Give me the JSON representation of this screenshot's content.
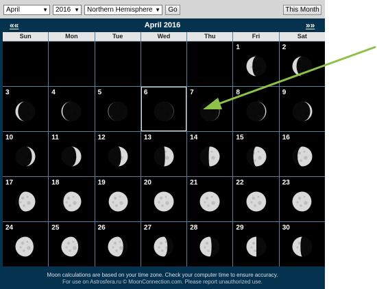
{
  "controls": {
    "month": "April",
    "year": "2016",
    "hemisphere": "Northern Hemisphere",
    "go_label": "Go",
    "this_month_label": "This Month"
  },
  "calendar": {
    "prev_label": "««",
    "next_label": "»»",
    "title": "April 2016",
    "weekdays": [
      "Sun",
      "Mon",
      "Tue",
      "Wed",
      "Thu",
      "Fri",
      "Sat"
    ],
    "today": 6,
    "days": [
      {
        "day": 1,
        "illum": 0.3,
        "waxing": false
      },
      {
        "day": 2,
        "illum": 0.21,
        "waxing": false
      },
      {
        "day": 3,
        "illum": 0.13,
        "waxing": false
      },
      {
        "day": 4,
        "illum": 0.06,
        "waxing": false
      },
      {
        "day": 5,
        "illum": 0.02,
        "waxing": false
      },
      {
        "day": 6,
        "illum": 0.01,
        "waxing": true
      },
      {
        "day": 7,
        "illum": 0.02,
        "waxing": true
      },
      {
        "day": 8,
        "illum": 0.05,
        "waxing": true
      },
      {
        "day": 9,
        "illum": 0.1,
        "waxing": true
      },
      {
        "day": 10,
        "illum": 0.17,
        "waxing": true
      },
      {
        "day": 11,
        "illum": 0.25,
        "waxing": true
      },
      {
        "day": 12,
        "illum": 0.34,
        "waxing": true
      },
      {
        "day": 13,
        "illum": 0.44,
        "waxing": true
      },
      {
        "day": 14,
        "illum": 0.55,
        "waxing": true
      },
      {
        "day": 15,
        "illum": 0.65,
        "waxing": true
      },
      {
        "day": 16,
        "illum": 0.74,
        "waxing": true
      },
      {
        "day": 17,
        "illum": 0.83,
        "waxing": true
      },
      {
        "day": 18,
        "illum": 0.9,
        "waxing": true
      },
      {
        "day": 19,
        "illum": 0.96,
        "waxing": true
      },
      {
        "day": 20,
        "illum": 0.99,
        "waxing": true
      },
      {
        "day": 21,
        "illum": 1.0,
        "waxing": true
      },
      {
        "day": 22,
        "illum": 0.99,
        "waxing": false
      },
      {
        "day": 23,
        "illum": 0.96,
        "waxing": false
      },
      {
        "day": 24,
        "illum": 0.91,
        "waxing": false
      },
      {
        "day": 25,
        "illum": 0.85,
        "waxing": false
      },
      {
        "day": 26,
        "illum": 0.77,
        "waxing": false
      },
      {
        "day": 27,
        "illum": 0.68,
        "waxing": false
      },
      {
        "day": 28,
        "illum": 0.59,
        "waxing": false
      },
      {
        "day": 29,
        "illum": 0.5,
        "waxing": false
      },
      {
        "day": 30,
        "illum": 0.41,
        "waxing": false
      }
    ],
    "first_weekday_index": 5
  },
  "footer": {
    "line1": "Moon calculations are based on your time zone. Check your computer time to ensure accuracy.",
    "line2": "For use on Astrosfera.ru  © MoonConnection.com. Please report unauthorized use."
  },
  "colors": {
    "calendar_bg": "#04324f",
    "grid_line": "#5a7f98",
    "moon_light": "#d9d9d9",
    "annotation_arrow": "#8fc14a"
  }
}
